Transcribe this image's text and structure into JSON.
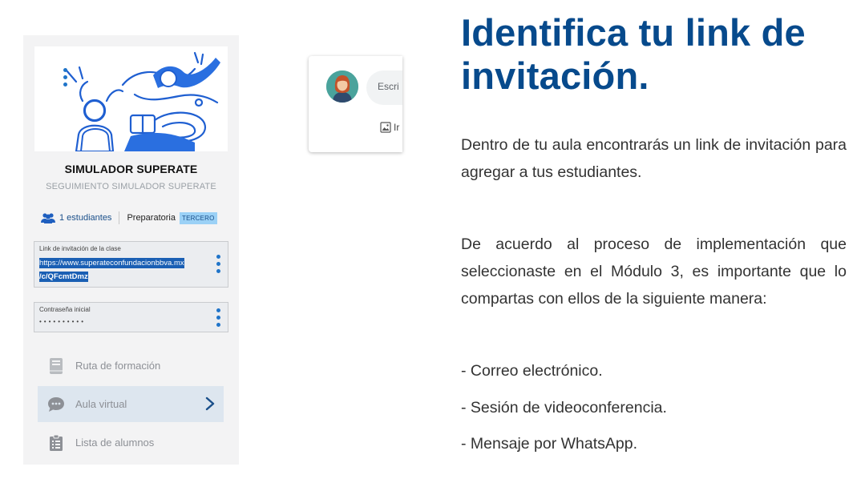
{
  "class_card": {
    "title": "SIMULADOR SUPERATE",
    "subtitle": "SEGUIMIENTO SIMULADOR SUPERATE",
    "students": "1 estudiantes",
    "level": "Preparatoria",
    "grade_badge": "TERCERO",
    "invite_link": {
      "label": "Link de invitación de la clase",
      "value_line1": "https://www.superateconfundacionbbva.mx",
      "value_line2": "/c/QFcmtDmz"
    },
    "password": {
      "label": "Contraseña inicial",
      "value": "••••••••••"
    },
    "nav": [
      {
        "label": "Ruta de formación",
        "icon": "book-icon"
      },
      {
        "label": "Aula virtual",
        "icon": "chat-bubble-icon"
      },
      {
        "label": "Lista de alumnos",
        "icon": "clipboard-list-icon"
      }
    ]
  },
  "comment_card": {
    "placeholder": "Escri",
    "attach_label": "Ir"
  },
  "content": {
    "heading_line1": "Identifica tu link de",
    "heading_line2": "invitación.",
    "paragraph1": "Dentro de tu aula encontrarás un link de invitación para agregar a tus estudiantes.",
    "paragraph2": "De acuerdo al proceso de implementación que seleccionaste en el Módulo 3, es importante que lo compartas con ellos de la siguiente manera:",
    "bullets": [
      "- Correo electrónico.",
      "- Sesión de videoconferencia.",
      "- Mensaje por WhatsApp."
    ]
  },
  "colors": {
    "brand_blue": "#074a8c",
    "accent_blue": "#1f74c9",
    "selection_blue": "#1a5fb4",
    "badge_blue": "#9bd1f6",
    "panel_bg": "#f3f3f4"
  }
}
